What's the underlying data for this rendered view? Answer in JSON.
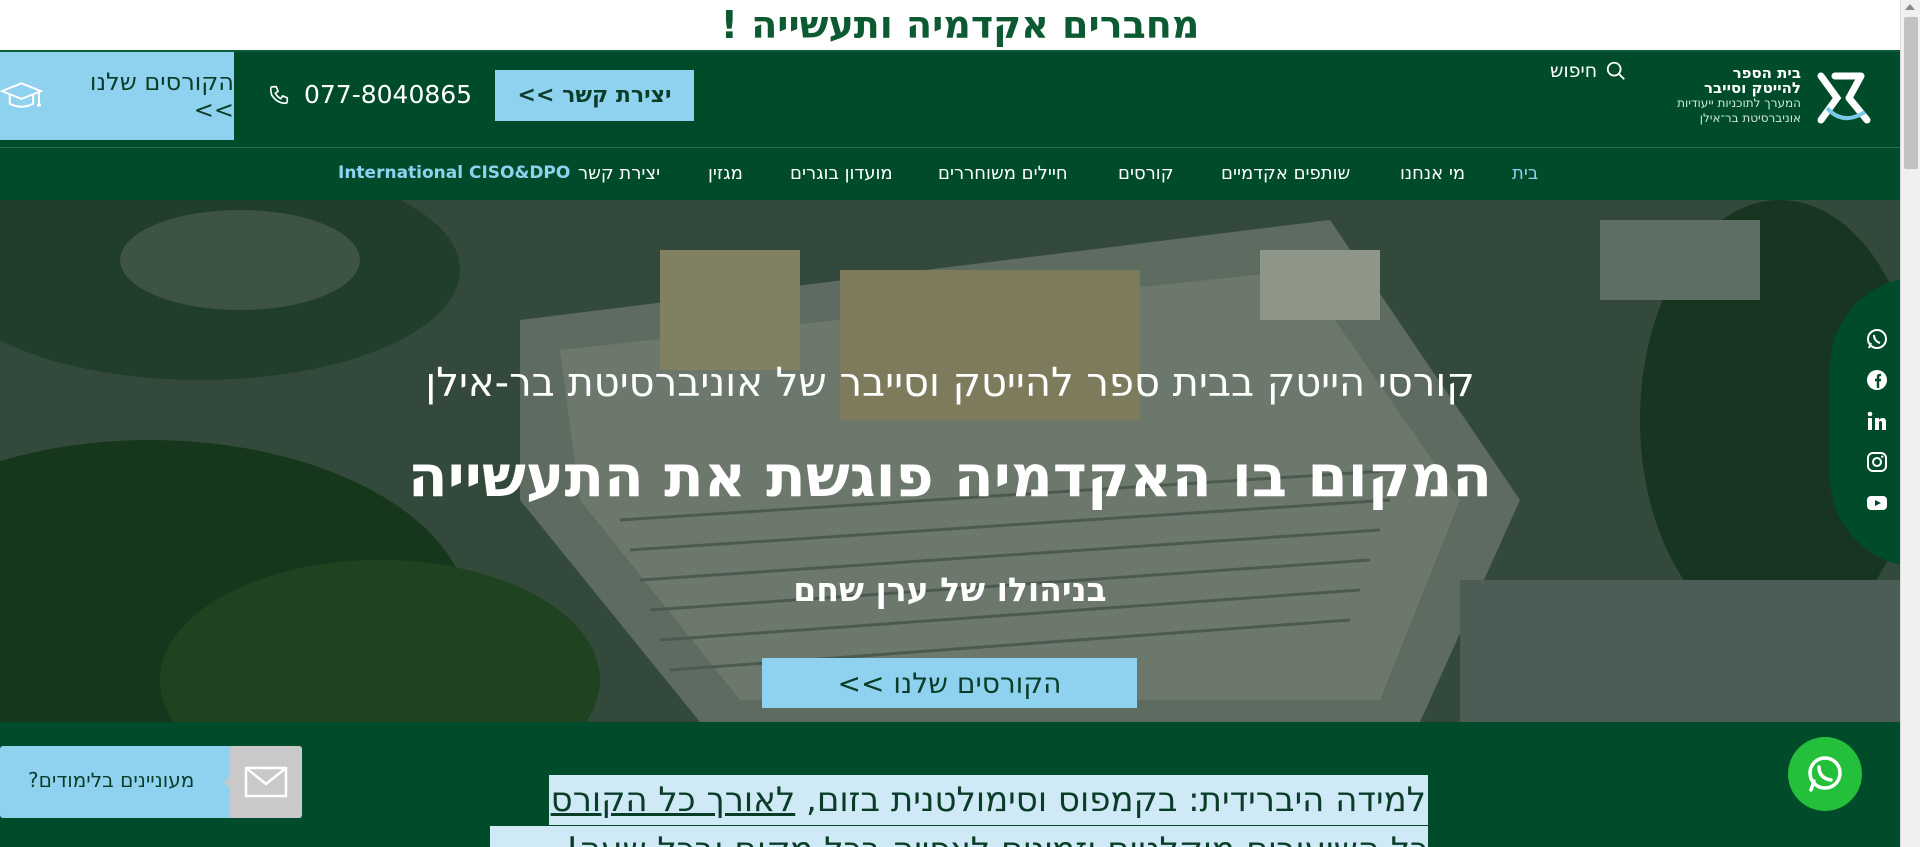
{
  "banner": {
    "text": "מחברים אקדמיה ותעשייה !"
  },
  "header": {
    "courses_button": "הקורסים שלנו >>",
    "phone": "077-8040865",
    "contact_button": "יצירת קשר >>",
    "search_label": "חיפוש",
    "logo": {
      "line1": "בית הספר",
      "line2": "להייטק וסייבר",
      "line3": "המערך לתוכניות ייעודיות",
      "line4": "אוניברסיטת בר־אילן"
    }
  },
  "nav": {
    "items": [
      {
        "label": "בית",
        "active": true
      },
      {
        "label": "מי אנחנו"
      },
      {
        "label": "שותפים אקדמיים"
      },
      {
        "label": "קורסים"
      },
      {
        "label": "חיילים משוחררים"
      },
      {
        "label": "מועדון בוגרים"
      },
      {
        "label": "מגזין"
      },
      {
        "label": "יצירת קשר"
      },
      {
        "label": "International CISO&DPO"
      }
    ]
  },
  "hero": {
    "subtitle": "קורסי הייטק בבית ספר להייטק וסייבר של אוניברסיטת בר-אילן",
    "title": "המקום בו האקדמיה פוגשת את התעשייה",
    "by": "בניהולו של ערן שחם",
    "cta": "הקורסים שלנו >>"
  },
  "social": {
    "icons": [
      "whatsapp-icon",
      "facebook-icon",
      "linkedin-icon",
      "instagram-icon",
      "youtube-icon"
    ]
  },
  "bottom": {
    "hybrid_prefix": "למידה היברידית:  בקמפוס וסימולטנית בזום, ",
    "hybrid_link": "לאורך כל הקורס",
    "hybrid_line2": "כל השיעורים מוקלטים וזמינים לצפייה בכל מקום ובכל שעה!",
    "interested_label": "מעוניינים בלימודים?"
  },
  "colors": {
    "dark_green": "#004c2a",
    "light_blue": "#8fd2ef",
    "whatsapp_green": "#25c03b"
  }
}
